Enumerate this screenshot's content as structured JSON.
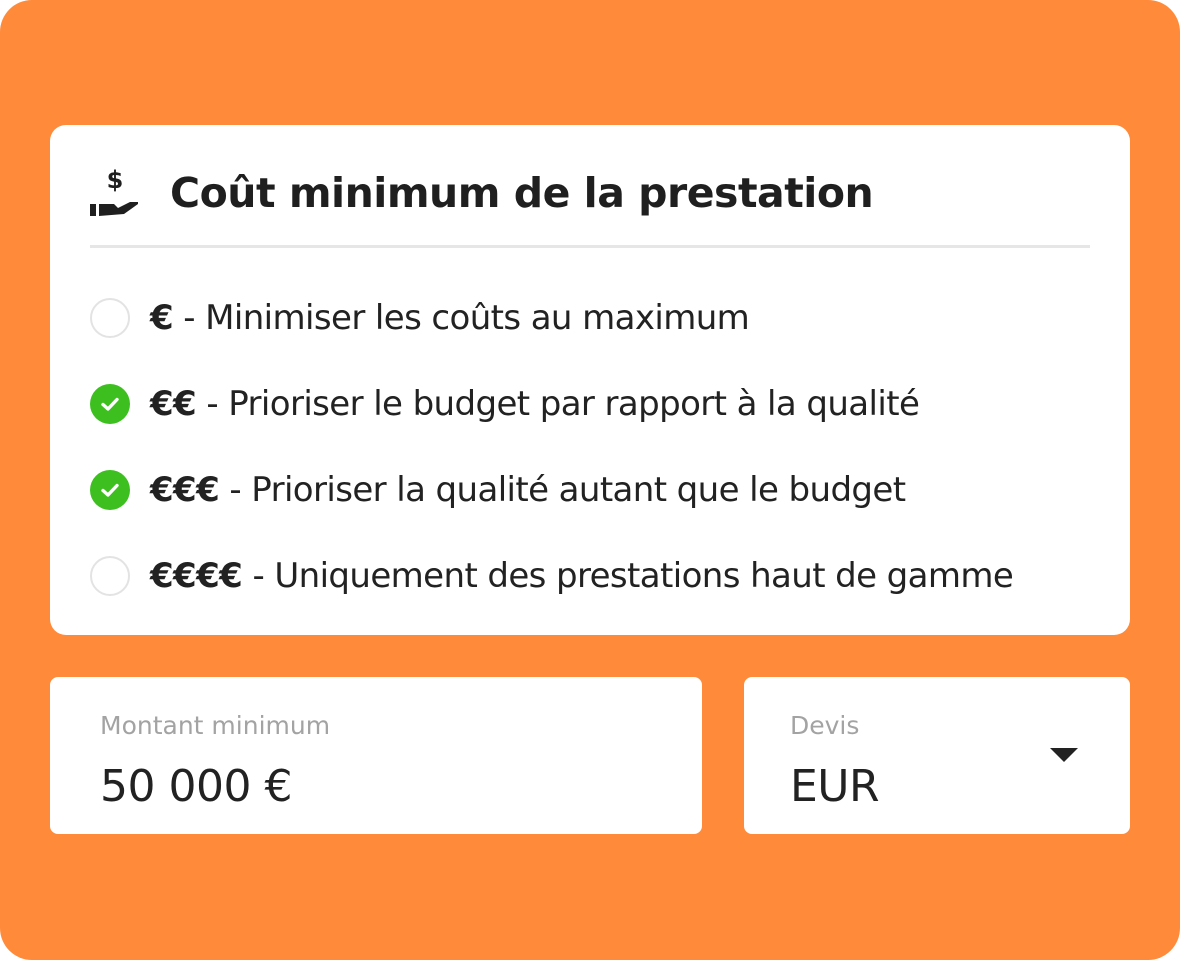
{
  "card": {
    "title": "Coût minimum de la prestation",
    "icon": "hand-dollar-icon"
  },
  "options": [
    {
      "level": "€",
      "sep": " - ",
      "text": "Minimiser les coûts au maximum",
      "checked": false
    },
    {
      "level": "€€",
      "sep": " - ",
      "text": "Prioriser le budget par rapport à la qualité",
      "checked": true
    },
    {
      "level": "€€€",
      "sep": " - ",
      "text": "Prioriser la qualité autant que le budget",
      "checked": true
    },
    {
      "level": "€€€€",
      "sep": " - ",
      "text": "Uniquement des prestations haut de gamme",
      "checked": false
    }
  ],
  "amount_field": {
    "label": "Montant minimum",
    "value": "50 000 €"
  },
  "currency_field": {
    "label": "Devis",
    "value": "EUR",
    "icon": "dropdown-arrow-icon"
  },
  "colors": {
    "background": "#ff8b3a",
    "check": "#3cbf1f",
    "text": "#222222",
    "label": "#a3a3a3"
  }
}
